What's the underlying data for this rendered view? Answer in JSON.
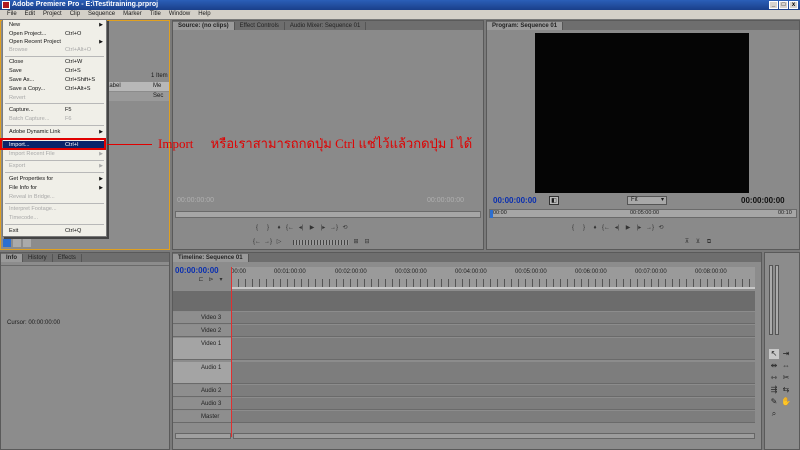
{
  "window": {
    "title": "Adobe Premiere Pro - E:\\Test\\training.prproj"
  },
  "menubar": [
    "File",
    "Edit",
    "Project",
    "Clip",
    "Sequence",
    "Marker",
    "Title",
    "Window",
    "Help"
  ],
  "file_menu": [
    {
      "label": "New",
      "shortcut": "",
      "submenu": true,
      "disabled": false
    },
    {
      "label": "Open Project...",
      "shortcut": "Ctrl+O",
      "disabled": false
    },
    {
      "label": "Open Recent Project",
      "shortcut": "",
      "submenu": true,
      "disabled": false
    },
    {
      "label": "Browse",
      "shortcut": "Ctrl+Alt+O",
      "disabled": true
    },
    {
      "label": "Close",
      "shortcut": "Ctrl+W",
      "disabled": false
    },
    {
      "label": "Save",
      "shortcut": "Ctrl+S",
      "disabled": false
    },
    {
      "label": "Save As...",
      "shortcut": "Ctrl+Shift+S",
      "disabled": false
    },
    {
      "label": "Save a Copy...",
      "shortcut": "Ctrl+Alt+S",
      "disabled": false
    },
    {
      "label": "Revert",
      "shortcut": "",
      "disabled": true
    },
    {
      "label": "Capture...",
      "shortcut": "F5",
      "disabled": false
    },
    {
      "label": "Batch Capture...",
      "shortcut": "F6",
      "disabled": true
    },
    {
      "label": "Adobe Dynamic Link",
      "shortcut": "",
      "submenu": true,
      "disabled": false
    },
    {
      "label": "Import...",
      "shortcut": "Ctrl+I",
      "disabled": false,
      "selected": true
    },
    {
      "label": "Import Recent File",
      "shortcut": "",
      "submenu": true,
      "disabled": true
    },
    {
      "label": "Export",
      "shortcut": "",
      "submenu": true,
      "disabled": true
    },
    {
      "label": "Get Properties for",
      "shortcut": "",
      "submenu": true,
      "disabled": false
    },
    {
      "label": "File Info for",
      "shortcut": "",
      "submenu": true,
      "disabled": false
    },
    {
      "label": "Reveal in Bridge...",
      "shortcut": "",
      "disabled": true
    },
    {
      "label": "Interpret Footage...",
      "shortcut": "",
      "disabled": true
    },
    {
      "label": "Timecode...",
      "shortcut": "",
      "disabled": true
    },
    {
      "label": "Exit",
      "shortcut": "Ctrl+Q",
      "disabled": false
    }
  ],
  "project_panel": {
    "items_count": "1 Item",
    "col_label": "Label",
    "col_media": "Me",
    "col_media2": "Sec"
  },
  "source_monitor": {
    "tabs": [
      "Source: (no clips)",
      "Effect Controls",
      "Audio Mixer: Sequence 01"
    ],
    "tc_left": "00:00:00:00",
    "tc_right": "00:00:00:00"
  },
  "program_monitor": {
    "tab": "Program: Sequence 01",
    "tc_left": "00:00:00:00",
    "fit": "Fit",
    "tc_right": "00:00:00:00",
    "ruler": [
      "00:00",
      "00:05:00:00",
      "00:10"
    ]
  },
  "info_panel": {
    "tabs": [
      "Info",
      "History",
      "Effects"
    ],
    "cursor": "Cursor:  00:00:00:00"
  },
  "timeline": {
    "tab": "Timeline: Sequence 01",
    "timecode": "00:00:00:00",
    "ruler": [
      "00:00",
      "00:01:00:00",
      "00:02:00:00",
      "00:03:00:00",
      "00:04:00:00",
      "00:05:00:00",
      "00:06:00:00",
      "00:07:00:00",
      "00:08:00:00"
    ],
    "tracks": [
      "Video 3",
      "Video 2",
      "Video 1",
      "Audio 1",
      "Audio 2",
      "Audio 3",
      "Master"
    ]
  },
  "annotation": {
    "label": "Import",
    "text": "หรือเราสามารถกดปุ่ม Ctrl แช่ไว้แล้วกดปุ่ม I ได้",
    "color": "#e00000"
  }
}
